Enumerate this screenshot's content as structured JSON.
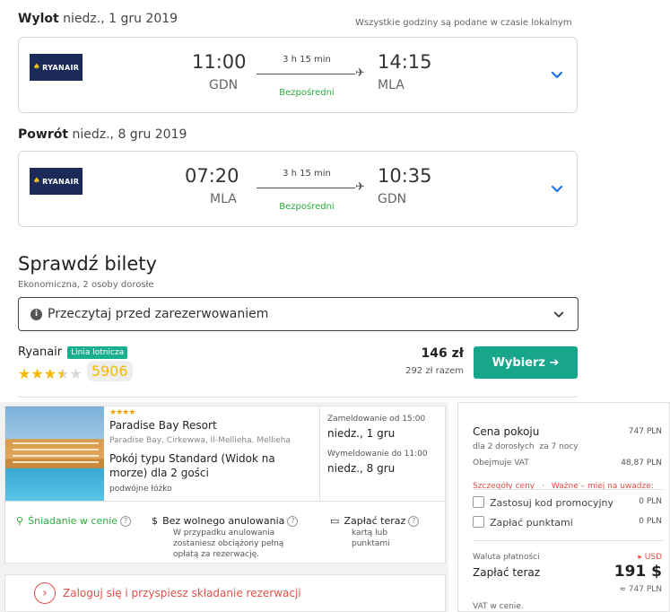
{
  "outbound": {
    "label": "Wylot",
    "date": "niedz., 1 gru 2019",
    "timezone_note": "Wszystkie godziny są podane w czasie lokalnym",
    "airline_logo": "RYANAIR",
    "depart_time": "11:00",
    "depart_airport": "GDN",
    "duration": "3 h 15 min",
    "stops": "Bezpośredni",
    "arrive_time": "14:15",
    "arrive_airport": "MLA"
  },
  "return": {
    "label": "Powrót",
    "date": "niedz., 8 gru 2019",
    "airline_logo": "RYANAIR",
    "depart_time": "07:20",
    "depart_airport": "MLA",
    "duration": "3 h 15 min",
    "stops": "Bezpośredni",
    "arrive_time": "10:35",
    "arrive_airport": "GDN"
  },
  "tickets": {
    "title": "Sprawdź bilety",
    "subtitle": "Ekonomiczna, 2 osoby dorosłe",
    "notice": "Przeczytaj przed zarezerwowaniem",
    "provider": "Ryanair",
    "provider_badge": "Linia lotnicza",
    "rating_stars": 3.5,
    "review_count": "5906",
    "price": "146 zł",
    "price_total": "292 zł razem",
    "select_button": "Wybierz"
  },
  "hotel": {
    "stars": "★★★★",
    "name": "Paradise Bay Resort",
    "address": "Paradise Bay, Cirkewwa, Il-Mellieha, Mellieha",
    "room": "Pokój typu Standard (Widok na morze) dla 2 gości",
    "bed": "podwójne łóżko",
    "checkin_label": "Zameldowanie od 15:00",
    "checkin_value": "niedz., 1 gru",
    "checkout_label": "Wymeldowanie do 11:00",
    "checkout_value": "niedz., 8 gru",
    "feature_breakfast": "Śniadanie w cenie",
    "feature_cancel_title": "Bez wolnego anulowania",
    "feature_cancel_text": "W przypadku anulowania zostaniesz obciążony pełną opłatą za rezerwację.",
    "feature_pay_title": "Zapłać teraz",
    "feature_pay_text": "kartą lub punktami",
    "login_text": "Zaloguj się i przyspiesz składanie rezerwacji"
  },
  "price_panel": {
    "title": "Cena pokoju",
    "title_value": "747 PLN",
    "guests": "dla 2 dorosłych",
    "nights": "za 7 nocy",
    "vat_label": "Obejmuje VAT",
    "vat_value": "48,87 PLN",
    "details_link": "Szczegóły ceny",
    "important_link": "Ważne – miej na uwadze:",
    "promo_label": "Zastosuj kod promocyjny",
    "promo_value": "0 PLN",
    "points_label": "Zapłać punktami",
    "points_value": "0 PLN",
    "currency_label": "Waluta płatności",
    "currency_value": "USD",
    "pay_now_label": "Zapłać teraz",
    "pay_now_value": "191 $",
    "pay_now_approx": "≈ 747 PLN",
    "vat_included": "VAT w cenie."
  },
  "colors": {
    "accent_green": "#17a68a",
    "direct_green": "#2cab3e",
    "chevron_blue": "#1a73e8",
    "ryanair_navy": "#1b2a59",
    "warning_red": "#e1504a"
  }
}
